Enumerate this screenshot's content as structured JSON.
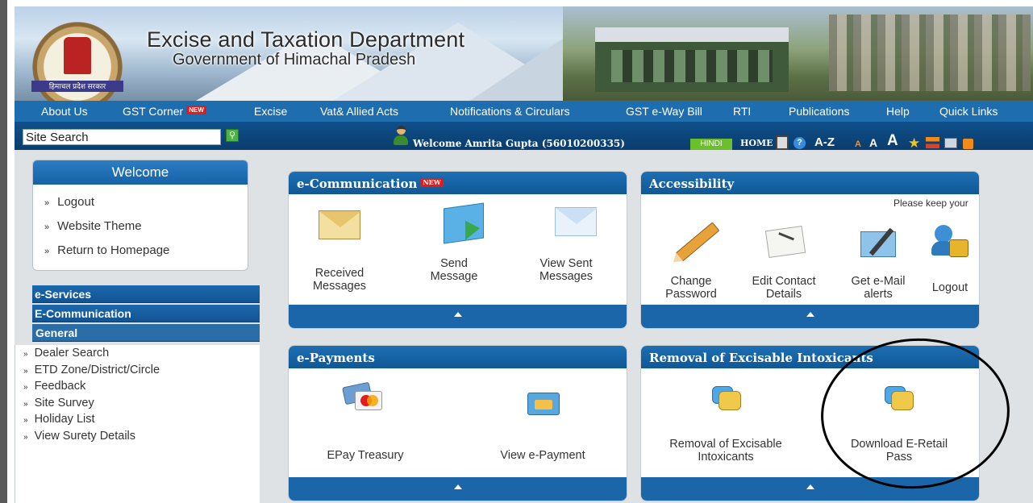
{
  "banner": {
    "title": "Excise and Taxation Department",
    "subtitle": "Government of Himachal Pradesh",
    "emblem_caption": "हिमाचल प्रदेश सरकार"
  },
  "nav": {
    "items": [
      {
        "label": "About Us"
      },
      {
        "label": "GST Corner",
        "badge": "NEW"
      },
      {
        "label": "Excise"
      },
      {
        "label": "Vat& Allied Acts"
      },
      {
        "label": "Notifications & Circulars"
      },
      {
        "label": "GST e-Way Bill"
      },
      {
        "label": "RTI"
      },
      {
        "label": "Publications"
      },
      {
        "label": "Help"
      },
      {
        "label": "Quick Links"
      }
    ]
  },
  "toolbar": {
    "search_value": "Site Search",
    "welcome": "Welcome Amrita Gupta (56010200335)",
    "hindi": "HINDI",
    "home": "HOME",
    "help_glyph": "?",
    "az": "A-Z",
    "font_small": "A",
    "font_medium": "A",
    "font_large": "A"
  },
  "sidebar": {
    "welcome_title": "Welcome",
    "welcome_links": [
      "Logout",
      "Website Theme",
      "Return to Homepage"
    ],
    "bullet": "»",
    "categories": [
      "e-Services",
      "E-Communication",
      "General"
    ],
    "general_items": [
      "Dealer Search",
      "ETD Zone/District/Circle",
      "Feedback",
      "Site Survey",
      "Holiday List",
      "View Surety Details"
    ]
  },
  "panels": {
    "ecomm": {
      "title": "e-Communication",
      "badge": "NEW",
      "tiles": [
        {
          "line1": "Received",
          "line2": "Messages",
          "icon": "envelope-icon"
        },
        {
          "line1": "Send",
          "line2": "Message",
          "icon": "send-message-icon"
        },
        {
          "line1": "View Sent",
          "line2": "Messages",
          "icon": "sent-envelope-icon"
        }
      ]
    },
    "access": {
      "title": "Accessibility",
      "note": "Please keep your",
      "tiles": [
        {
          "line1": "Change",
          "line2": "Password",
          "icon": "pencil-icon"
        },
        {
          "line1": "Edit Contact",
          "line2": "Details",
          "icon": "edit-document-icon"
        },
        {
          "line1": "Get e-Mail",
          "line2": "alerts",
          "icon": "email-alert-icon"
        },
        {
          "line1": "Logout",
          "line2": "",
          "icon": "users-lock-icon"
        }
      ]
    },
    "epay": {
      "title": "e-Payments",
      "tiles": [
        {
          "line1": "EPay Treasury",
          "icon": "cards-icon"
        },
        {
          "line1": "View e-Payment",
          "icon": "payment-card-icon"
        }
      ]
    },
    "removal": {
      "title": "Removal of Excisable Intoxicants",
      "tiles": [
        {
          "line1": "Removal of Excisable",
          "line2": "Intoxicants",
          "icon": "chat-bubbles-icon"
        },
        {
          "line1": "Download E-Retail",
          "line2": "Pass",
          "icon": "chat-bubbles-icon"
        }
      ]
    }
  },
  "colors": {
    "nav_blue": "#1e6dae",
    "toolbar_dark": "#0f4f8a",
    "new_badge": "#e31b1b",
    "hindi_green": "#6cbf2c"
  }
}
